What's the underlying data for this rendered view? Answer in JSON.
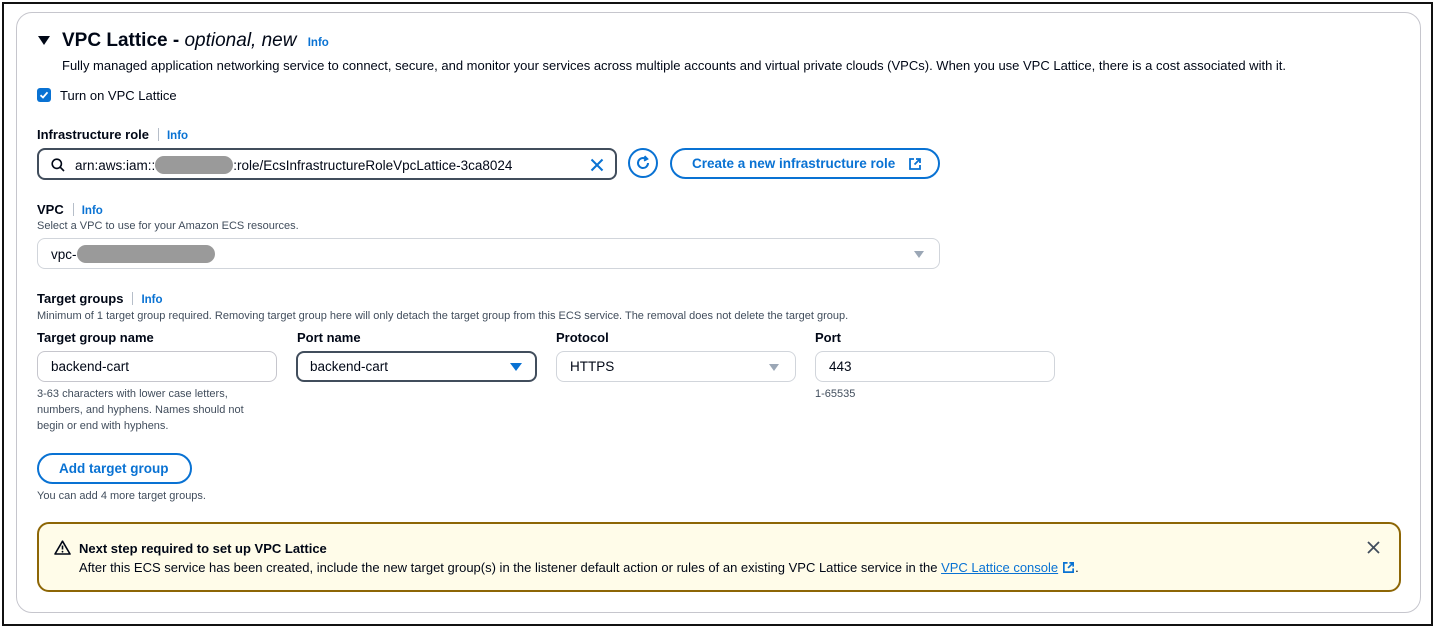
{
  "section": {
    "title": "VPC Lattice - ",
    "title_italic": "optional, new",
    "info": "Info",
    "description": "Fully managed application networking service to connect, secure, and monitor your services across multiple accounts and virtual private clouds (VPCs). When you use VPC Lattice, there is a cost associated with it."
  },
  "checkbox": {
    "label": "Turn on VPC Lattice",
    "checked": true
  },
  "infra_role": {
    "label": "Infrastructure role",
    "info": "Info",
    "value_prefix": "arn:aws:iam::",
    "value_suffix": ":role/EcsInfrastructureRoleVpcLattice-3ca8024",
    "create_button": "Create a new infrastructure role"
  },
  "vpc": {
    "label": "VPC",
    "info": "Info",
    "description": "Select a VPC to use for your Amazon ECS resources.",
    "value_prefix": "vpc-"
  },
  "target_groups": {
    "label": "Target groups",
    "info": "Info",
    "description": "Minimum of 1 target group required. Removing target group here will only detach the target group from this ECS service. The removal does not delete the target group.",
    "columns": {
      "name": "Target group name",
      "port_name": "Port name",
      "protocol": "Protocol",
      "port": "Port"
    },
    "row": {
      "name": "backend-cart",
      "port_name": "backend-cart",
      "protocol": "HTTPS",
      "port": "443"
    },
    "name_hint_1": "3-63 characters with lower case letters,",
    "name_hint_2": "numbers, and hyphens. Names should not",
    "name_hint_3": "begin or end with hyphens.",
    "port_hint": "1-65535",
    "add_button": "Add target group",
    "add_hint": "You can add 4 more target groups."
  },
  "alert": {
    "title": "Next step required to set up VPC Lattice",
    "body": "After this ECS service has been created, include the new target group(s) in the listener default action or rules of an existing VPC Lattice service in the ",
    "link": "VPC Lattice console",
    "body_end": "."
  },
  "colors": {
    "accent": "#0972d3",
    "warning_border": "#8d6605",
    "warning_bg": "#fffce9"
  }
}
